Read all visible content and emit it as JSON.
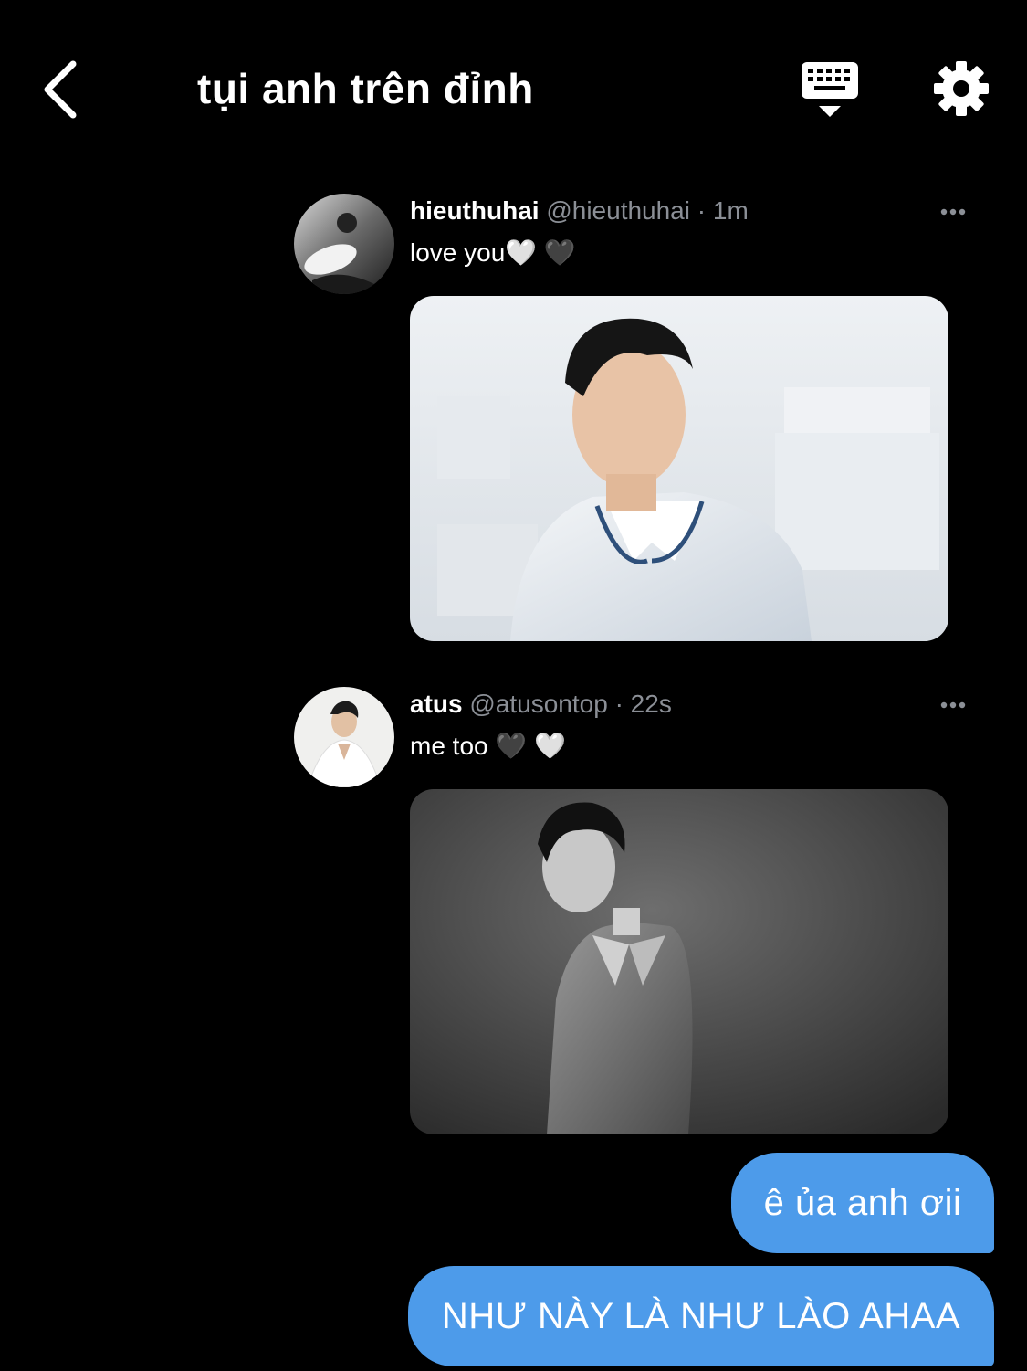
{
  "header": {
    "title": "tụi anh trên đỉnh",
    "back_icon": "chevron-left-icon",
    "keyboard_icon": "keyboard-icon",
    "settings_icon": "gear-icon"
  },
  "tweets": [
    {
      "name": "hieuthuhai",
      "handle": "@hieuthuhai",
      "separator": "·",
      "time": "1m",
      "text": "love you🤍 🖤",
      "more_icon": "more-horizontal-icon",
      "media_icon": "photo"
    },
    {
      "name": "atus",
      "handle": "@atusontop",
      "separator": "·",
      "time": "22s",
      "text": "me too 🖤 🤍",
      "more_icon": "more-horizontal-icon",
      "media_icon": "photo"
    }
  ],
  "messages": [
    {
      "text": "ê ủa anh ơii"
    },
    {
      "text": "NHƯ NÀY LÀ NHƯ LÀO AHAA"
    }
  ],
  "colors": {
    "background": "#000000",
    "bubble": "#4d9bea",
    "muted_text": "#8b8f96"
  }
}
